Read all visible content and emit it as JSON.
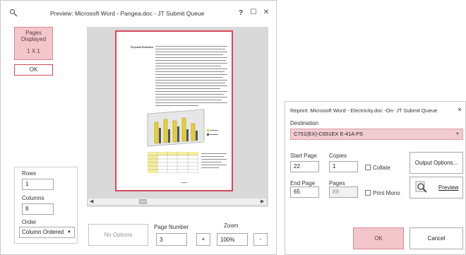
{
  "preview_window": {
    "title": "Preview:  Microsoft Word - Pangea.doc  -  JT Submit Queue",
    "help_label": "?",
    "maximize_label": "☐",
    "close_label": "✕",
    "pages_displayed_line1": "Pages",
    "pages_displayed_line2": "Displayed",
    "pages_displayed_value": "1 X 1",
    "ok_label": "OK",
    "rows_label": "Rows",
    "rows_value": "1",
    "columns_label": "Columns",
    "columns_value": "8",
    "order_label": "Order",
    "order_value": "Column Ordered",
    "no_options_label": "No Options",
    "page_number_label": "Page Number",
    "page_number_value": "3",
    "plus_label": "+",
    "zoom_label": "Zoom",
    "zoom_value": "100%",
    "minus_label": "-",
    "doc_heading": "Physical Evolution"
  },
  "reprint_window": {
    "title": "Reprint:  Microsoft Word - Electricity.doc  -On-  JT Submit Queue",
    "close_label": "✕",
    "destination_label": "Destination",
    "destination_value": "C751(EX)-C651EX E-41A PS",
    "start_page_label": "Start Page",
    "start_page_value": "22",
    "copies_label": "Copies",
    "copies_value": "1",
    "collate_label": "Collate",
    "end_page_label": "End Page",
    "end_page_value": "65",
    "pages_label": "Pages",
    "pages_value": "88",
    "print_mono_label": "Print Mono",
    "output_options_label": "Output Options...",
    "preview_label": "Preview",
    "ok_label": "OK",
    "cancel_label": "Cancel"
  }
}
